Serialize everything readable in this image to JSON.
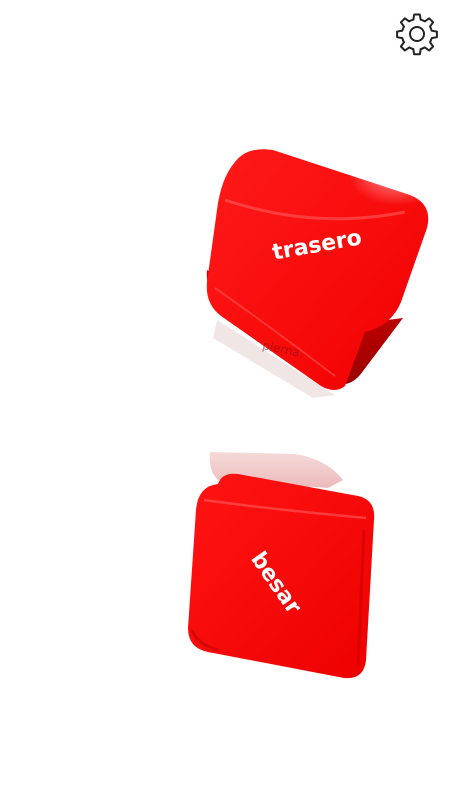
{
  "settings": {
    "icon": "gear-icon"
  },
  "dice": [
    {
      "name": "action-die",
      "face_label": "trasero",
      "side_label": "pierna",
      "color": "#ff0000"
    },
    {
      "name": "body-part-die",
      "face_label": "besar",
      "color": "#ff0000"
    }
  ],
  "colors": {
    "background": "#ffffff",
    "die_red": "#ff0000",
    "die_dark_red": "#b80000",
    "icon_stroke": "#222222"
  }
}
